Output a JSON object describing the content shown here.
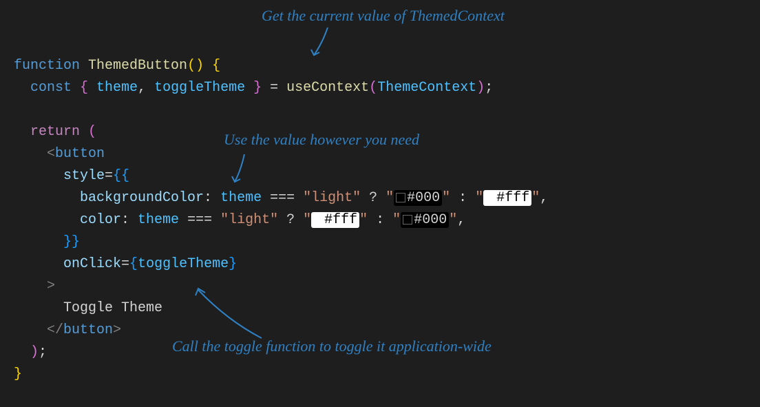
{
  "annotations": {
    "top": "Get the current value of ThemedContext",
    "middle": "Use the value however you need",
    "bottom": "Call the toggle function to toggle it application-wide"
  },
  "code": {
    "line1": {
      "function": "function",
      "name": "ThemedButton",
      "parens": "()",
      "brace": " {"
    },
    "line2": {
      "const": "const",
      "destructure_open": " { ",
      "theme": "theme",
      "comma": ", ",
      "toggleTheme": "toggleTheme",
      "destructure_close": " } ",
      "equals": "= ",
      "useContext": "useContext",
      "paren_open": "(",
      "ThemeContext": "ThemeContext",
      "paren_close": ")",
      "semi": ";"
    },
    "line4": {
      "return": "return",
      "paren": " ("
    },
    "line5": {
      "tag_open": "<",
      "button": "button"
    },
    "line6": {
      "style": "style",
      "equals": "=",
      "brace_open": "{{"
    },
    "line7": {
      "backgroundColor": "backgroundColor",
      "colon": ": ",
      "theme": "theme",
      "triple_eq": " === ",
      "light_str": "\"light\"",
      "ternary_q": " ? ",
      "quote1": "\"",
      "hash000": "#000",
      "quote2": "\"",
      "ternary_colon": " : ",
      "quote3": "\"",
      "hashfff": "#fff",
      "quote4": "\"",
      "comma": ","
    },
    "line8": {
      "color": "color",
      "colon": ": ",
      "theme": "theme",
      "triple_eq": " === ",
      "light_str": "\"light\"",
      "ternary_q": " ? ",
      "quote1": "\"",
      "hashfff": "#fff",
      "quote2": "\"",
      "ternary_colon": " : ",
      "quote3": "\"",
      "hash000": "#000",
      "quote4": "\"",
      "comma": ","
    },
    "line9": {
      "brace_close": "}}"
    },
    "line10": {
      "onClick": "onClick",
      "equals": "=",
      "brace_open": "{",
      "toggleTheme": "toggleTheme",
      "brace_close": "}"
    },
    "line11": {
      "close": ">"
    },
    "line12": {
      "text": "Toggle Theme"
    },
    "line13": {
      "tag_open": "</",
      "button": "button",
      "tag_close": ">"
    },
    "line14": {
      "paren": ")",
      "semi": ";"
    },
    "line15": {
      "brace": "}"
    }
  }
}
